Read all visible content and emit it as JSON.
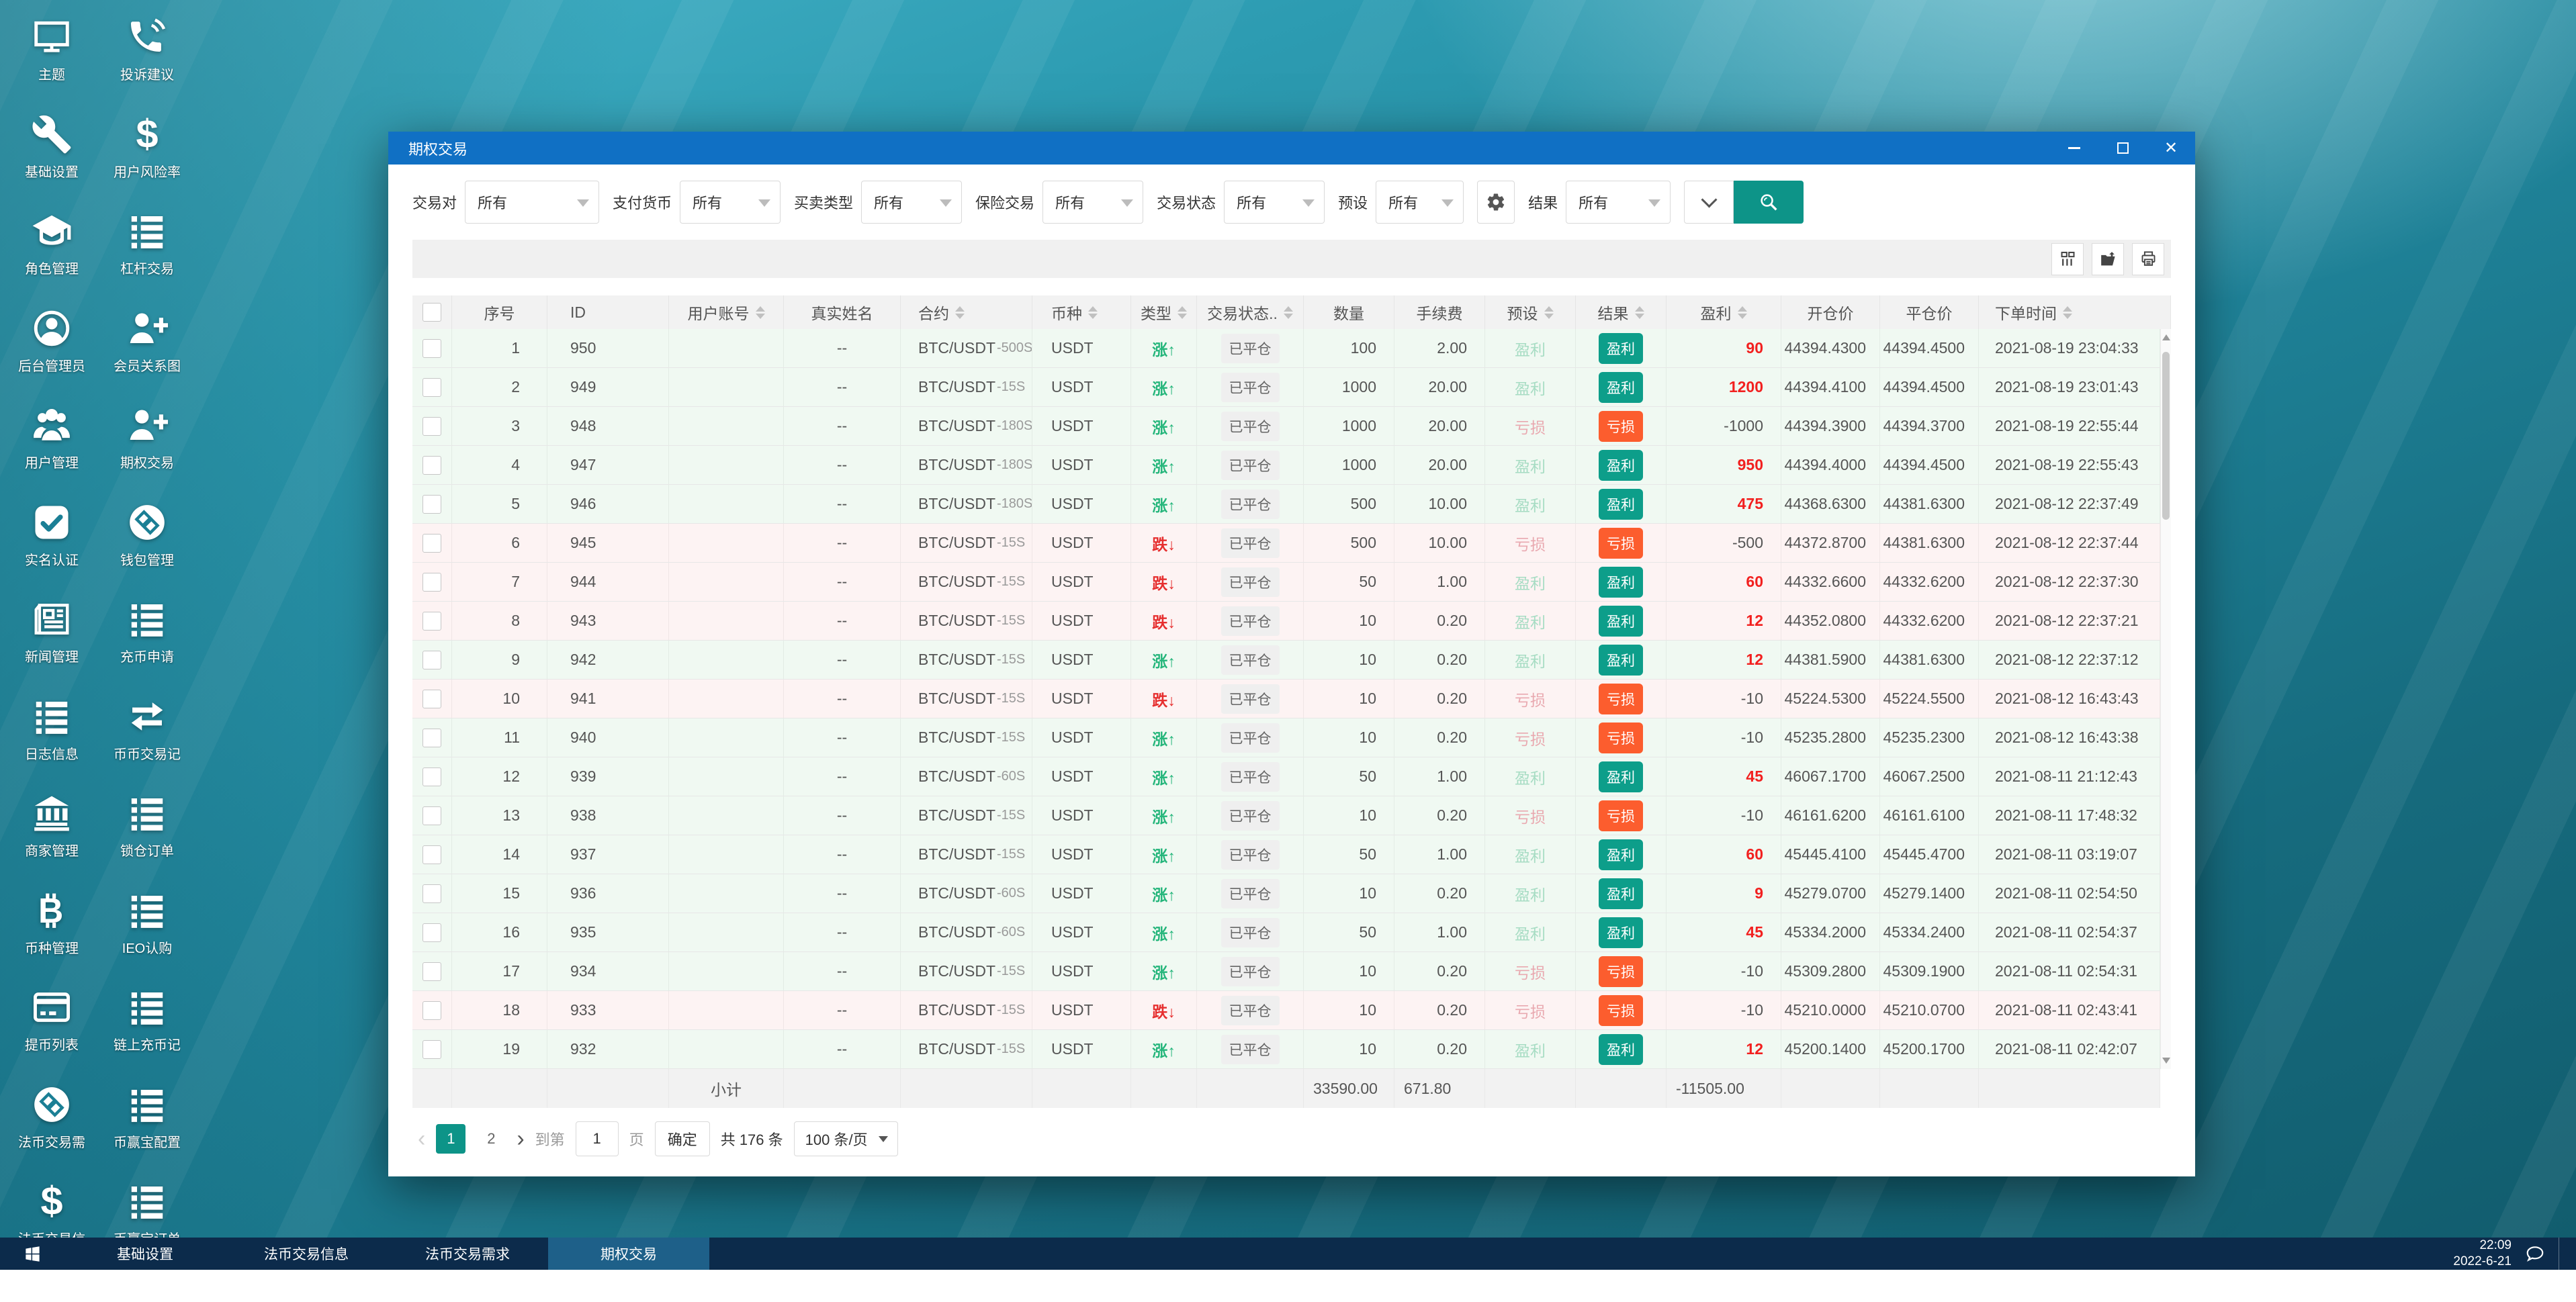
{
  "desktop": {
    "shortcuts": [
      {
        "icon": "monitor-icon",
        "label": "主题"
      },
      {
        "icon": "phone-icon",
        "label": "投诉建议"
      },
      {
        "icon": "wrench-icon",
        "label": "基础设置"
      },
      {
        "icon": "dollar-icon",
        "label": "用户风险率"
      },
      {
        "icon": "graduation-cap-icon",
        "label": "角色管理"
      },
      {
        "icon": "list-icon",
        "label": "杠杆交易"
      },
      {
        "icon": "user-circle-icon",
        "label": "后台管理员"
      },
      {
        "icon": "user-plus-icon",
        "label": "会员关系图"
      },
      {
        "icon": "users-icon",
        "label": "用户管理"
      },
      {
        "icon": "user-plus-icon",
        "label": "期权交易"
      },
      {
        "icon": "check-square-icon",
        "label": "实名认证"
      },
      {
        "icon": "wallet-icon",
        "label": "钱包管理"
      },
      {
        "icon": "newspaper-icon",
        "label": "新闻管理"
      },
      {
        "icon": "list-icon",
        "label": "充币申请"
      },
      {
        "icon": "list-icon",
        "label": "日志信息"
      },
      {
        "icon": "swap-arrows-icon",
        "label": "币币交易记"
      },
      {
        "icon": "bank-icon",
        "label": "商家管理"
      },
      {
        "icon": "list-icon",
        "label": "锁仓订单"
      },
      {
        "icon": "bitcoin-icon",
        "label": "币种管理"
      },
      {
        "icon": "list-icon",
        "label": "IEO认购"
      },
      {
        "icon": "card-icon",
        "label": "提币列表"
      },
      {
        "icon": "list-icon",
        "label": "链上充币记"
      },
      {
        "icon": "wallet-icon",
        "label": "法币交易需"
      },
      {
        "icon": "list-icon",
        "label": "币赢宝配置"
      },
      {
        "icon": "dollar-icon",
        "label": "法币交易信"
      },
      {
        "icon": "list-icon",
        "label": "币赢宝订单"
      }
    ]
  },
  "window": {
    "title": "期权交易",
    "accent_color": "#1070c4",
    "search_color": "#0d9488",
    "filters": [
      {
        "label": "交易对",
        "value": "所有"
      },
      {
        "label": "支付货币",
        "value": "所有"
      },
      {
        "label": "买卖类型",
        "value": "所有"
      },
      {
        "label": "保险交易",
        "value": "所有"
      },
      {
        "label": "交易状态",
        "value": "所有"
      },
      {
        "label": "预设",
        "value": "所有"
      },
      {
        "label": "结果",
        "value": "所有"
      }
    ],
    "toolbar_icons": [
      "columns-icon",
      "export-icon",
      "print-icon"
    ],
    "table": {
      "columns": [
        {
          "key": "check",
          "label": "",
          "sortable": false
        },
        {
          "key": "no",
          "label": "序号",
          "sortable": false
        },
        {
          "key": "id",
          "label": "ID",
          "sortable": false
        },
        {
          "key": "account",
          "label": "用户账号",
          "sortable": true
        },
        {
          "key": "name",
          "label": "真实姓名",
          "sortable": false
        },
        {
          "key": "contract",
          "label": "合约",
          "sortable": true
        },
        {
          "key": "currency",
          "label": "币种",
          "sortable": true
        },
        {
          "key": "type",
          "label": "类型",
          "sortable": true
        },
        {
          "key": "status",
          "label": "交易状态..",
          "sortable": true
        },
        {
          "key": "qty",
          "label": "数量",
          "sortable": false
        },
        {
          "key": "fee",
          "label": "手续费",
          "sortable": false
        },
        {
          "key": "preset",
          "label": "预设",
          "sortable": true
        },
        {
          "key": "result",
          "label": "结果",
          "sortable": true
        },
        {
          "key": "profit",
          "label": "盈利",
          "sortable": true
        },
        {
          "key": "open",
          "label": "开仓价",
          "sortable": false
        },
        {
          "key": "close",
          "label": "平仓价",
          "sortable": false
        },
        {
          "key": "time",
          "label": "下单时间",
          "sortable": true
        }
      ],
      "rows": [
        {
          "no": "1",
          "id": "950",
          "account": "",
          "name": "--",
          "contract": "BTC/USDT",
          "period": "-500S",
          "currency": "USDT",
          "type": "涨↑",
          "trend": "up",
          "status": "已平仓",
          "qty": "100",
          "fee": "2.00",
          "preset": "盈利",
          "result": "盈利",
          "profit": "90",
          "open": "44394.4300",
          "close": "44394.4500",
          "time": "2021-08-19 23:04:33"
        },
        {
          "no": "2",
          "id": "949",
          "account": "",
          "name": "--",
          "contract": "BTC/USDT",
          "period": "-15S",
          "currency": "USDT",
          "type": "涨↑",
          "trend": "up",
          "status": "已平仓",
          "qty": "1000",
          "fee": "20.00",
          "preset": "盈利",
          "result": "盈利",
          "profit": "1200",
          "open": "44394.4100",
          "close": "44394.4500",
          "time": "2021-08-19 23:01:43"
        },
        {
          "no": "3",
          "id": "948",
          "account": "",
          "name": "--",
          "contract": "BTC/USDT",
          "period": "-180S",
          "currency": "USDT",
          "type": "涨↑",
          "trend": "up",
          "status": "已平仓",
          "qty": "1000",
          "fee": "20.00",
          "preset": "亏损",
          "result": "亏损",
          "profit": "-1000",
          "open": "44394.3900",
          "close": "44394.3700",
          "time": "2021-08-19 22:55:44"
        },
        {
          "no": "4",
          "id": "947",
          "account": "",
          "name": "--",
          "contract": "BTC/USDT",
          "period": "-180S",
          "currency": "USDT",
          "type": "涨↑",
          "trend": "up",
          "status": "已平仓",
          "qty": "1000",
          "fee": "20.00",
          "preset": "盈利",
          "result": "盈利",
          "profit": "950",
          "open": "44394.4000",
          "close": "44394.4500",
          "time": "2021-08-19 22:55:43"
        },
        {
          "no": "5",
          "id": "946",
          "account": "",
          "name": "--",
          "contract": "BTC/USDT",
          "period": "-180S",
          "currency": "USDT",
          "type": "涨↑",
          "trend": "up",
          "status": "已平仓",
          "qty": "500",
          "fee": "10.00",
          "preset": "盈利",
          "result": "盈利",
          "profit": "475",
          "open": "44368.6300",
          "close": "44381.6300",
          "time": "2021-08-12 22:37:49"
        },
        {
          "no": "6",
          "id": "945",
          "account": "",
          "name": "--",
          "contract": "BTC/USDT",
          "period": "-15S",
          "currency": "USDT",
          "type": "跌↓",
          "trend": "down",
          "status": "已平仓",
          "qty": "500",
          "fee": "10.00",
          "preset": "亏损",
          "result": "亏损",
          "profit": "-500",
          "open": "44372.8700",
          "close": "44381.6300",
          "time": "2021-08-12 22:37:44"
        },
        {
          "no": "7",
          "id": "944",
          "account": "",
          "name": "--",
          "contract": "BTC/USDT",
          "period": "-15S",
          "currency": "USDT",
          "type": "跌↓",
          "trend": "down",
          "status": "已平仓",
          "qty": "50",
          "fee": "1.00",
          "preset": "盈利",
          "result": "盈利",
          "profit": "60",
          "open": "44332.6600",
          "close": "44332.6200",
          "time": "2021-08-12 22:37:30"
        },
        {
          "no": "8",
          "id": "943",
          "account": "",
          "name": "--",
          "contract": "BTC/USDT",
          "period": "-15S",
          "currency": "USDT",
          "type": "跌↓",
          "trend": "down",
          "status": "已平仓",
          "qty": "10",
          "fee": "0.20",
          "preset": "盈利",
          "result": "盈利",
          "profit": "12",
          "open": "44352.0800",
          "close": "44332.6200",
          "time": "2021-08-12 22:37:21"
        },
        {
          "no": "9",
          "id": "942",
          "account": "",
          "name": "--",
          "contract": "BTC/USDT",
          "period": "-15S",
          "currency": "USDT",
          "type": "涨↑",
          "trend": "up",
          "status": "已平仓",
          "qty": "10",
          "fee": "0.20",
          "preset": "盈利",
          "result": "盈利",
          "profit": "12",
          "open": "44381.5900",
          "close": "44381.6300",
          "time": "2021-08-12 22:37:12"
        },
        {
          "no": "10",
          "id": "941",
          "account": "",
          "name": "--",
          "contract": "BTC/USDT",
          "period": "-15S",
          "currency": "USDT",
          "type": "跌↓",
          "trend": "down",
          "status": "已平仓",
          "qty": "10",
          "fee": "0.20",
          "preset": "亏损",
          "result": "亏损",
          "profit": "-10",
          "open": "45224.5300",
          "close": "45224.5500",
          "time": "2021-08-12 16:43:43"
        },
        {
          "no": "11",
          "id": "940",
          "account": "",
          "name": "--",
          "contract": "BTC/USDT",
          "period": "-15S",
          "currency": "USDT",
          "type": "涨↑",
          "trend": "up",
          "status": "已平仓",
          "qty": "10",
          "fee": "0.20",
          "preset": "亏损",
          "result": "亏损",
          "profit": "-10",
          "open": "45235.2800",
          "close": "45235.2300",
          "time": "2021-08-12 16:43:38"
        },
        {
          "no": "12",
          "id": "939",
          "account": "",
          "name": "--",
          "contract": "BTC/USDT",
          "period": "-60S",
          "currency": "USDT",
          "type": "涨↑",
          "trend": "up",
          "status": "已平仓",
          "qty": "50",
          "fee": "1.00",
          "preset": "盈利",
          "result": "盈利",
          "profit": "45",
          "open": "46067.1700",
          "close": "46067.2500",
          "time": "2021-08-11 21:12:43"
        },
        {
          "no": "13",
          "id": "938",
          "account": "",
          "name": "--",
          "contract": "BTC/USDT",
          "period": "-15S",
          "currency": "USDT",
          "type": "涨↑",
          "trend": "up",
          "status": "已平仓",
          "qty": "10",
          "fee": "0.20",
          "preset": "亏损",
          "result": "亏损",
          "profit": "-10",
          "open": "46161.6200",
          "close": "46161.6100",
          "time": "2021-08-11 17:48:32"
        },
        {
          "no": "14",
          "id": "937",
          "account": "",
          "name": "--",
          "contract": "BTC/USDT",
          "period": "-15S",
          "currency": "USDT",
          "type": "涨↑",
          "trend": "up",
          "status": "已平仓",
          "qty": "50",
          "fee": "1.00",
          "preset": "盈利",
          "result": "盈利",
          "profit": "60",
          "open": "45445.4100",
          "close": "45445.4700",
          "time": "2021-08-11 03:19:07"
        },
        {
          "no": "15",
          "id": "936",
          "account": "",
          "name": "--",
          "contract": "BTC/USDT",
          "period": "-60S",
          "currency": "USDT",
          "type": "涨↑",
          "trend": "up",
          "status": "已平仓",
          "qty": "10",
          "fee": "0.20",
          "preset": "盈利",
          "result": "盈利",
          "profit": "9",
          "open": "45279.0700",
          "close": "45279.1400",
          "time": "2021-08-11 02:54:50"
        },
        {
          "no": "16",
          "id": "935",
          "account": "",
          "name": "--",
          "contract": "BTC/USDT",
          "period": "-60S",
          "currency": "USDT",
          "type": "涨↑",
          "trend": "up",
          "status": "已平仓",
          "qty": "50",
          "fee": "1.00",
          "preset": "盈利",
          "result": "盈利",
          "profit": "45",
          "open": "45334.2000",
          "close": "45334.2400",
          "time": "2021-08-11 02:54:37"
        },
        {
          "no": "17",
          "id": "934",
          "account": "",
          "name": "--",
          "contract": "BTC/USDT",
          "period": "-15S",
          "currency": "USDT",
          "type": "涨↑",
          "trend": "up",
          "status": "已平仓",
          "qty": "10",
          "fee": "0.20",
          "preset": "亏损",
          "result": "亏损",
          "profit": "-10",
          "open": "45309.2800",
          "close": "45309.1900",
          "time": "2021-08-11 02:54:31"
        },
        {
          "no": "18",
          "id": "933",
          "account": "",
          "name": "--",
          "contract": "BTC/USDT",
          "period": "-15S",
          "currency": "USDT",
          "type": "跌↓",
          "trend": "down",
          "status": "已平仓",
          "qty": "10",
          "fee": "0.20",
          "preset": "亏损",
          "result": "亏损",
          "profit": "-10",
          "open": "45210.0000",
          "close": "45210.0700",
          "time": "2021-08-11 02:43:41"
        },
        {
          "no": "19",
          "id": "932",
          "account": "",
          "name": "--",
          "contract": "BTC/USDT",
          "period": "-15S",
          "currency": "USDT",
          "type": "涨↑",
          "trend": "up",
          "status": "已平仓",
          "qty": "10",
          "fee": "0.20",
          "preset": "盈利",
          "result": "盈利",
          "profit": "12",
          "open": "45200.1400",
          "close": "45200.1700",
          "time": "2021-08-11 02:42:07"
        }
      ],
      "subtotal": {
        "label": "小计",
        "qty": "33590.00",
        "fee": "671.80",
        "profit": "-11505.00"
      },
      "pagination": {
        "pages": [
          "1",
          "2"
        ],
        "active_page": "1",
        "goto_label": "到第",
        "goto_value": "1",
        "page_unit_label": "页",
        "confirm_label": "确定",
        "total_label": "共 176 条",
        "page_size_value": "100 条/页"
      }
    }
  },
  "taskbar": {
    "items": [
      {
        "label": "基础设置",
        "active": false
      },
      {
        "label": "法币交易信息",
        "active": false
      },
      {
        "label": "法币交易需求",
        "active": false
      },
      {
        "label": "期权交易",
        "active": true
      }
    ],
    "clock_time": "22:09",
    "clock_date": "2022-6-21"
  }
}
